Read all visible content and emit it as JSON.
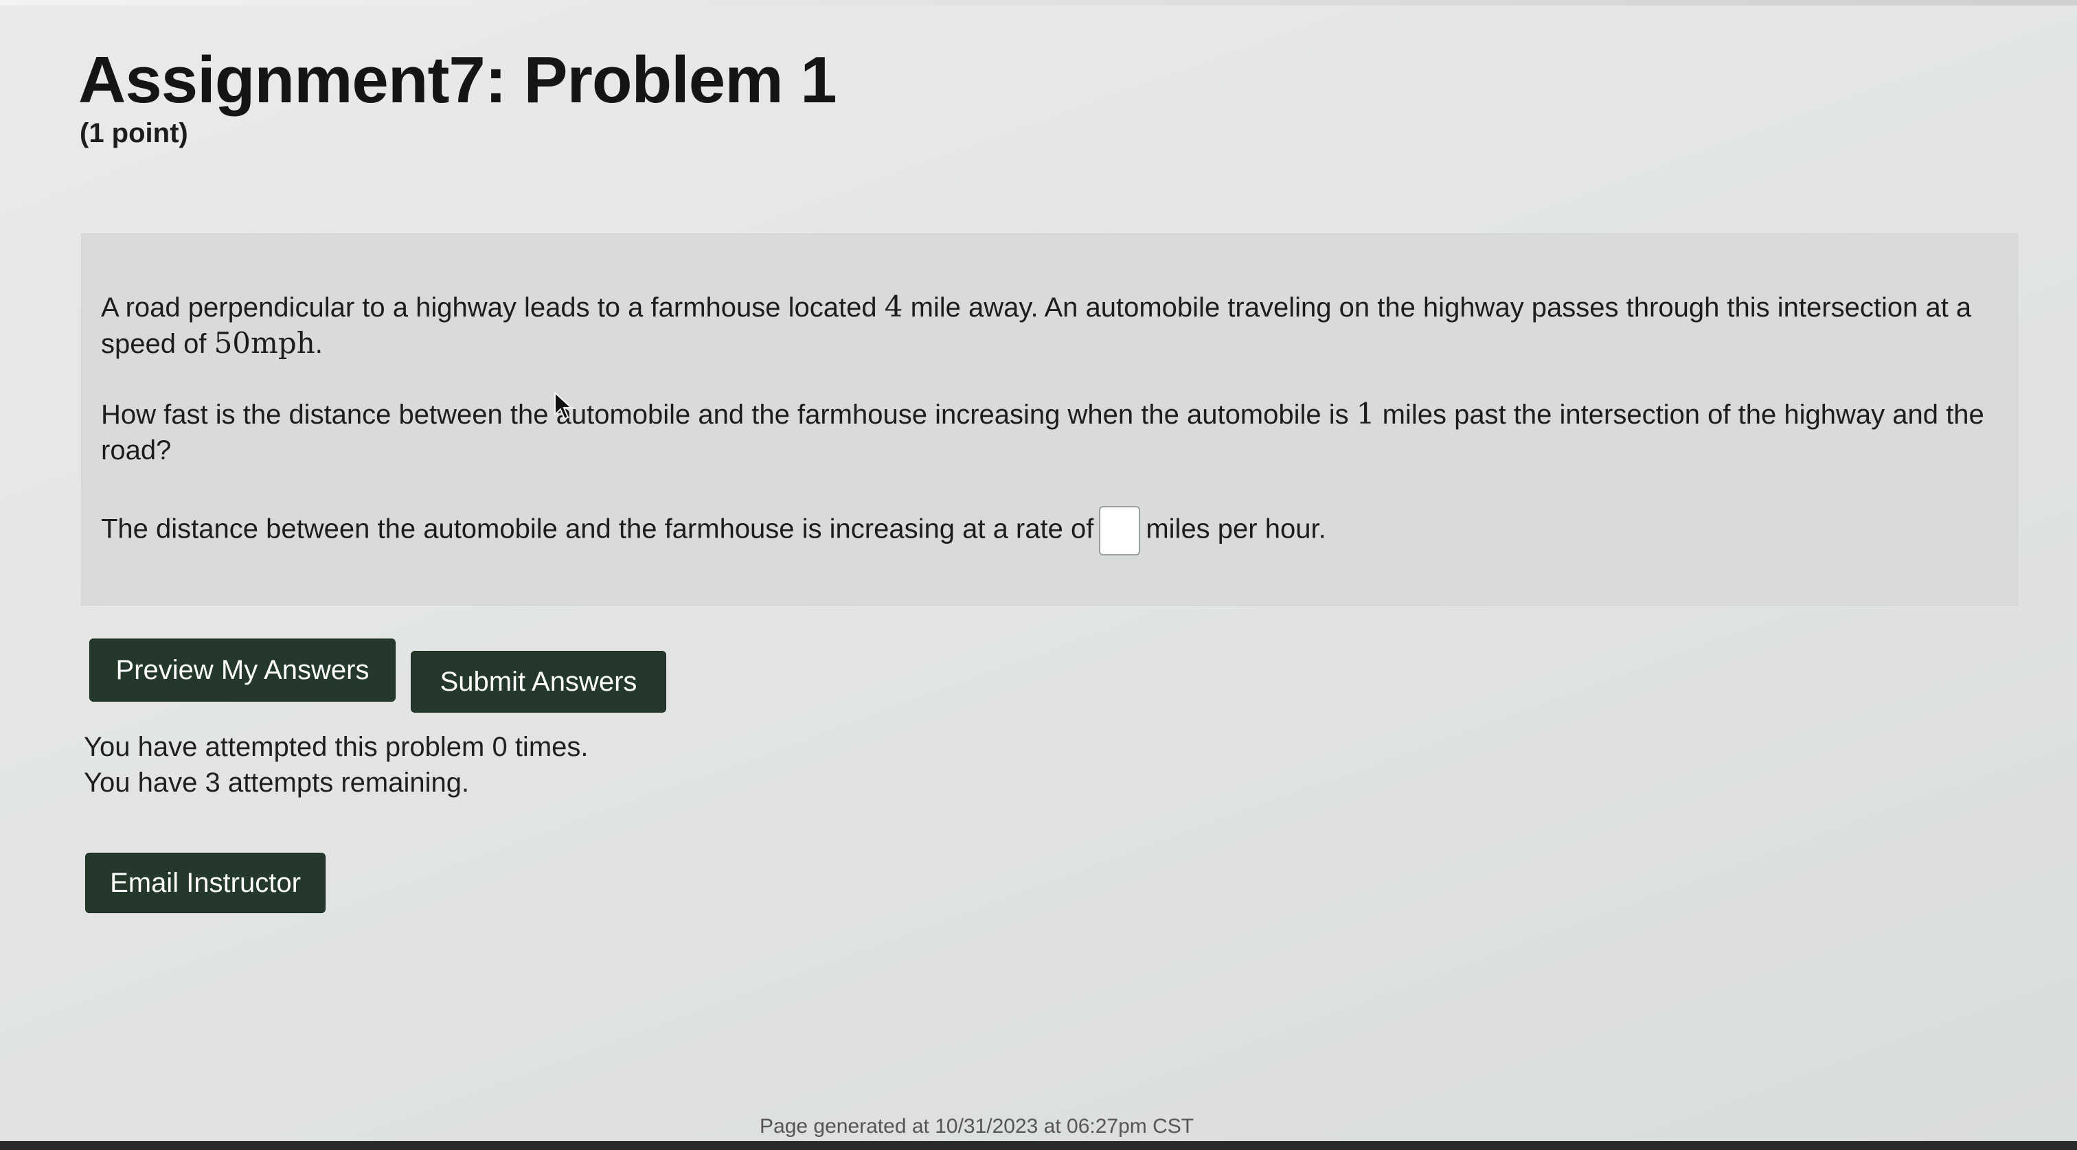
{
  "header": {
    "title": "Assignment7: Problem 1",
    "points": "(1 point)"
  },
  "problem": {
    "paragraph1_start": "A road perpendicular to a highway leads to a farmhouse located ",
    "farm_distance": "4",
    "paragraph1_mid": " mile away. An automobile traveling on the highway passes through this intersection at a speed of ",
    "speed": "50mph",
    "paragraph1_end": ".",
    "paragraph2_start": "How fast is the distance between the automobile and the farmhouse increasing when the automobile is ",
    "auto_distance": "1",
    "paragraph2_end": " miles past the intersection of the highway and the road?",
    "answer_prefix": "The distance between the automobile and the farmhouse is increasing at a rate of",
    "answer_value": "",
    "answer_suffix": "miles per hour."
  },
  "buttons": {
    "preview_label": "Preview My Answers",
    "submit_label": "Submit Answers",
    "email_label": "Email Instructor"
  },
  "status": {
    "attempted": "You have attempted this problem 0 times.",
    "remaining": "You have 3 attempts remaining."
  },
  "footer": {
    "generated": "Page generated at 10/31/2023 at 06:27pm CST"
  },
  "colors": {
    "button_bg": "#24382c",
    "button_text": "#ffffff",
    "problem_box_bg": "#d8dbd9"
  }
}
